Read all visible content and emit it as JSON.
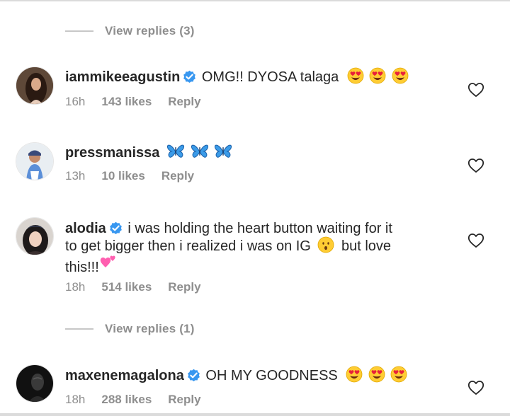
{
  "replies_top": {
    "label": "View replies (3)"
  },
  "replies_mid": {
    "label": "View replies (1)"
  },
  "comments": [
    {
      "username": "iammikeeagustin",
      "verified": true,
      "text": "OMG!! DYOSA talaga",
      "emoji": [
        "heart-eyes",
        "heart-eyes",
        "heart-eyes"
      ],
      "time": "16h",
      "likes": "143 likes",
      "reply": "Reply"
    },
    {
      "username": "pressmanissa",
      "verified": false,
      "text": "",
      "emoji": [
        "butterfly",
        "butterfly",
        "butterfly"
      ],
      "time": "13h",
      "likes": "10 likes",
      "reply": "Reply"
    },
    {
      "username": "alodia",
      "verified": true,
      "text_line1": "i was holding the heart button waiting for it",
      "text_line2a": "to get bigger then i realized i was on IG",
      "text_line2b": "but love",
      "text_line3": "this!!!",
      "emoji": [
        "hushed-face",
        "two-hearts"
      ],
      "time": "18h",
      "likes": "514 likes",
      "reply": "Reply"
    },
    {
      "username": "maxenemagalona",
      "verified": true,
      "text": "OH MY GOODNESS",
      "emoji": [
        "heart-eyes",
        "heart-eyes",
        "heart-eyes"
      ],
      "time": "18h",
      "likes": "288 likes",
      "reply": "Reply"
    }
  ],
  "colors": {
    "text": "#262626",
    "secondary": "#8e8e8e",
    "verified_blue": "#3897f0",
    "emoji_yellow": "#ffcc33",
    "heart_eye_red": "#e8203a",
    "butterfly_blue": "#3b9be8",
    "pink_heart": "#ff5fb0"
  },
  "icons": {
    "like": "heart-outline-icon",
    "verified": "verified-badge-icon"
  }
}
